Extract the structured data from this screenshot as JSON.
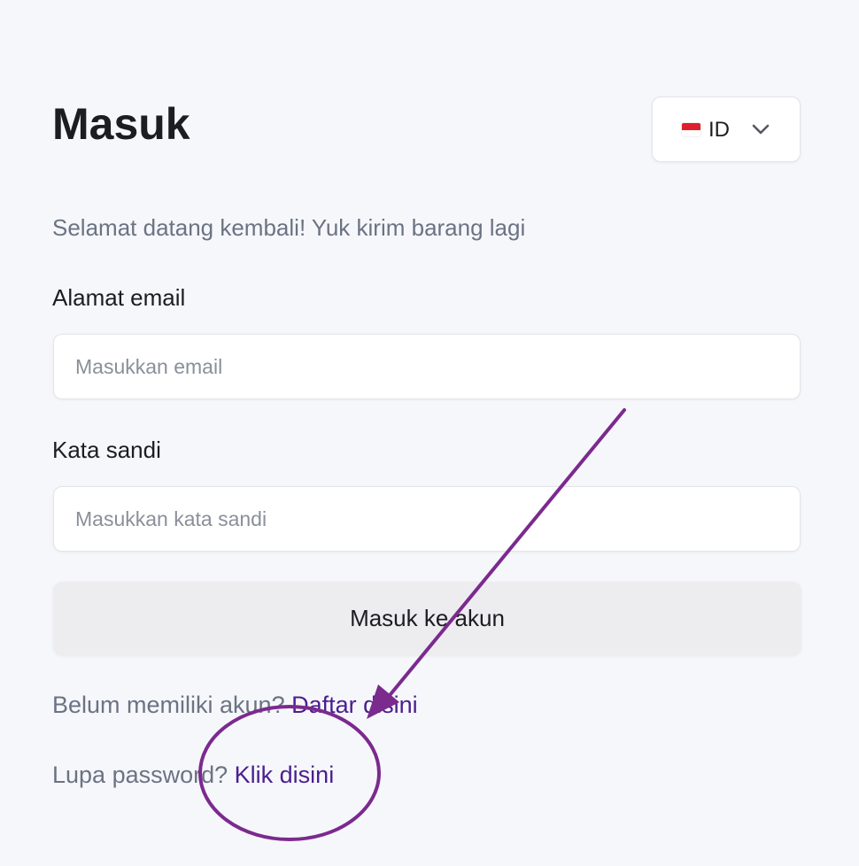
{
  "page": {
    "title": "Masuk",
    "subtitle": "Selamat datang kembali! Yuk kirim barang lagi"
  },
  "language_selector": {
    "flag": "indonesia-flag-icon",
    "value": "ID",
    "chevron": "chevron-down-icon"
  },
  "email": {
    "label": "Alamat email",
    "placeholder": "Masukkan email",
    "value": ""
  },
  "password": {
    "label": "Kata sandi",
    "placeholder": "Masukkan kata sandi",
    "value": ""
  },
  "submit_label": "Masuk ke akun",
  "register": {
    "prompt": "Belum memiliki akun?",
    "link": "Daftar disini"
  },
  "forgot": {
    "prompt": "Lupa password?",
    "link": "Klik disini"
  },
  "colors": {
    "background": "#f6f7fb",
    "link": "#4a1f8f",
    "muted_text": "#6b7383",
    "annotation": "#7b2a8e"
  }
}
